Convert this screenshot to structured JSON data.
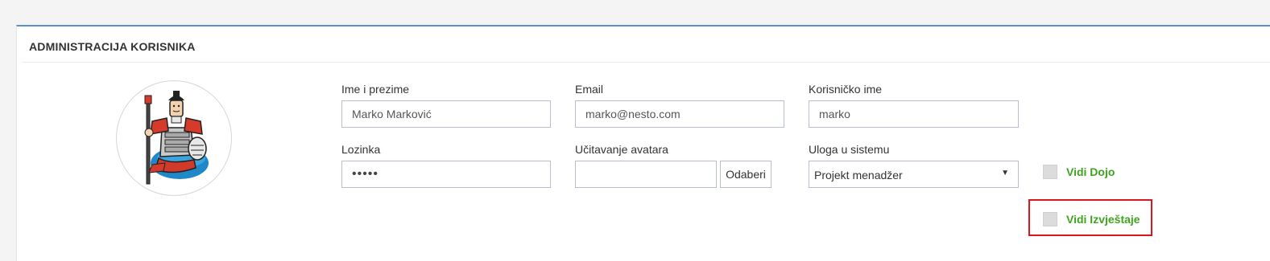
{
  "panel": {
    "title": "ADMINISTRACIJA KORISNIKA"
  },
  "avatar": {
    "icon": "samurai-avatar-icon"
  },
  "form": {
    "full_name": {
      "label": "Ime i prezime",
      "value": "Marko Marković"
    },
    "email": {
      "label": "Email",
      "value": "marko@nesto.com"
    },
    "username": {
      "label": "Korisničko ime",
      "value": "marko"
    },
    "password": {
      "label": "Lozinka",
      "value": "•••••"
    },
    "avatar_upload": {
      "label": "Učitavanje avatara",
      "value": "",
      "button": "Odaberi"
    },
    "role": {
      "label": "Uloga u sistemu",
      "selected": "Projekt menadžer",
      "arrow": "▼"
    }
  },
  "permissions": [
    {
      "label": "Vidi Dojo",
      "checked": false
    },
    {
      "label": "Vidi Izvještaje",
      "checked": false,
      "highlighted": true
    }
  ],
  "colors": {
    "accent_border": "#5b8fd4",
    "permission_label": "#3ea41f",
    "highlight_box": "#e0141e"
  }
}
